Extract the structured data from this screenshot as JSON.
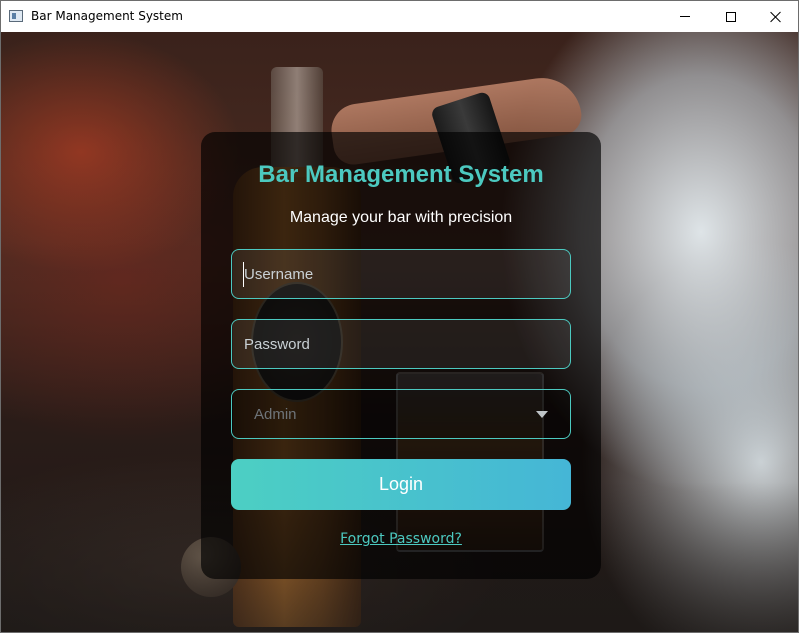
{
  "window": {
    "title": "Bar Management System"
  },
  "login": {
    "title": "Bar Management System",
    "subtitle": "Manage your bar with precision",
    "username_placeholder": "Username",
    "password_placeholder": "Password",
    "role_selected": "Admin",
    "login_label": "Login",
    "forgot_password_label": "Forgot Password?"
  },
  "colors": {
    "accent": "#4cc9c0",
    "button_gradient_start": "#4ccfc3",
    "button_gradient_end": "#45b6d6",
    "card_background": "rgba(0,0,0,0.66)"
  },
  "icons": {
    "app": "app-window-icon",
    "dropdown": "chevron-down-icon",
    "minimize": "minimize-icon",
    "maximize": "maximize-icon",
    "close": "close-icon"
  }
}
